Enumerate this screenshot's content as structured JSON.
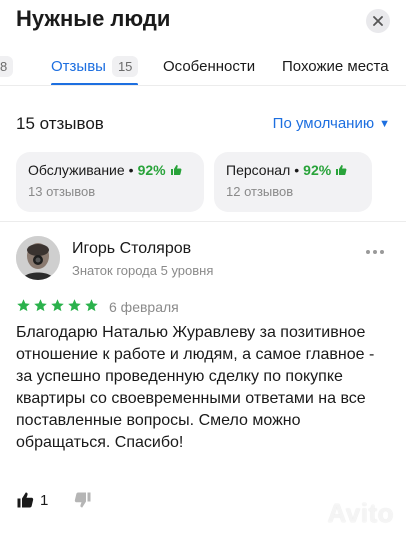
{
  "header": {
    "title": "Нужные люди",
    "close_icon": "close-icon"
  },
  "tabs": [
    {
      "label": "",
      "count": "8",
      "active": false
    },
    {
      "label": "Отзывы",
      "count": "15",
      "active": true
    },
    {
      "label": "Особенности",
      "count": "",
      "active": false
    },
    {
      "label": "Похожие места",
      "count": "",
      "active": false
    }
  ],
  "summary": {
    "review_count": "15 отзывов",
    "sort_label": "По умолчанию"
  },
  "aspects": [
    {
      "name": "Обслуживание",
      "percent": "92%",
      "reviews": "13 отзывов"
    },
    {
      "name": "Персонал",
      "percent": "92%",
      "reviews": "12 отзывов"
    }
  ],
  "review": {
    "author": "Игорь Столяров",
    "level": "Знаток города 5 уровня",
    "rating": 5,
    "date": "6 февраля",
    "text": "Благодарю Наталью Журавлеву за позитивное отношение к работе и людям, а самое главное - за успешно проведенную сделку по покупке квартиры со своевременными ответами на все поставленные вопросы. Смело можно обращаться. Спасибо!",
    "likes": "1"
  },
  "watermark": "Avito",
  "colors": {
    "accent": "#1d6fe0",
    "positive": "#29a33a",
    "star": "#2bb24c"
  }
}
